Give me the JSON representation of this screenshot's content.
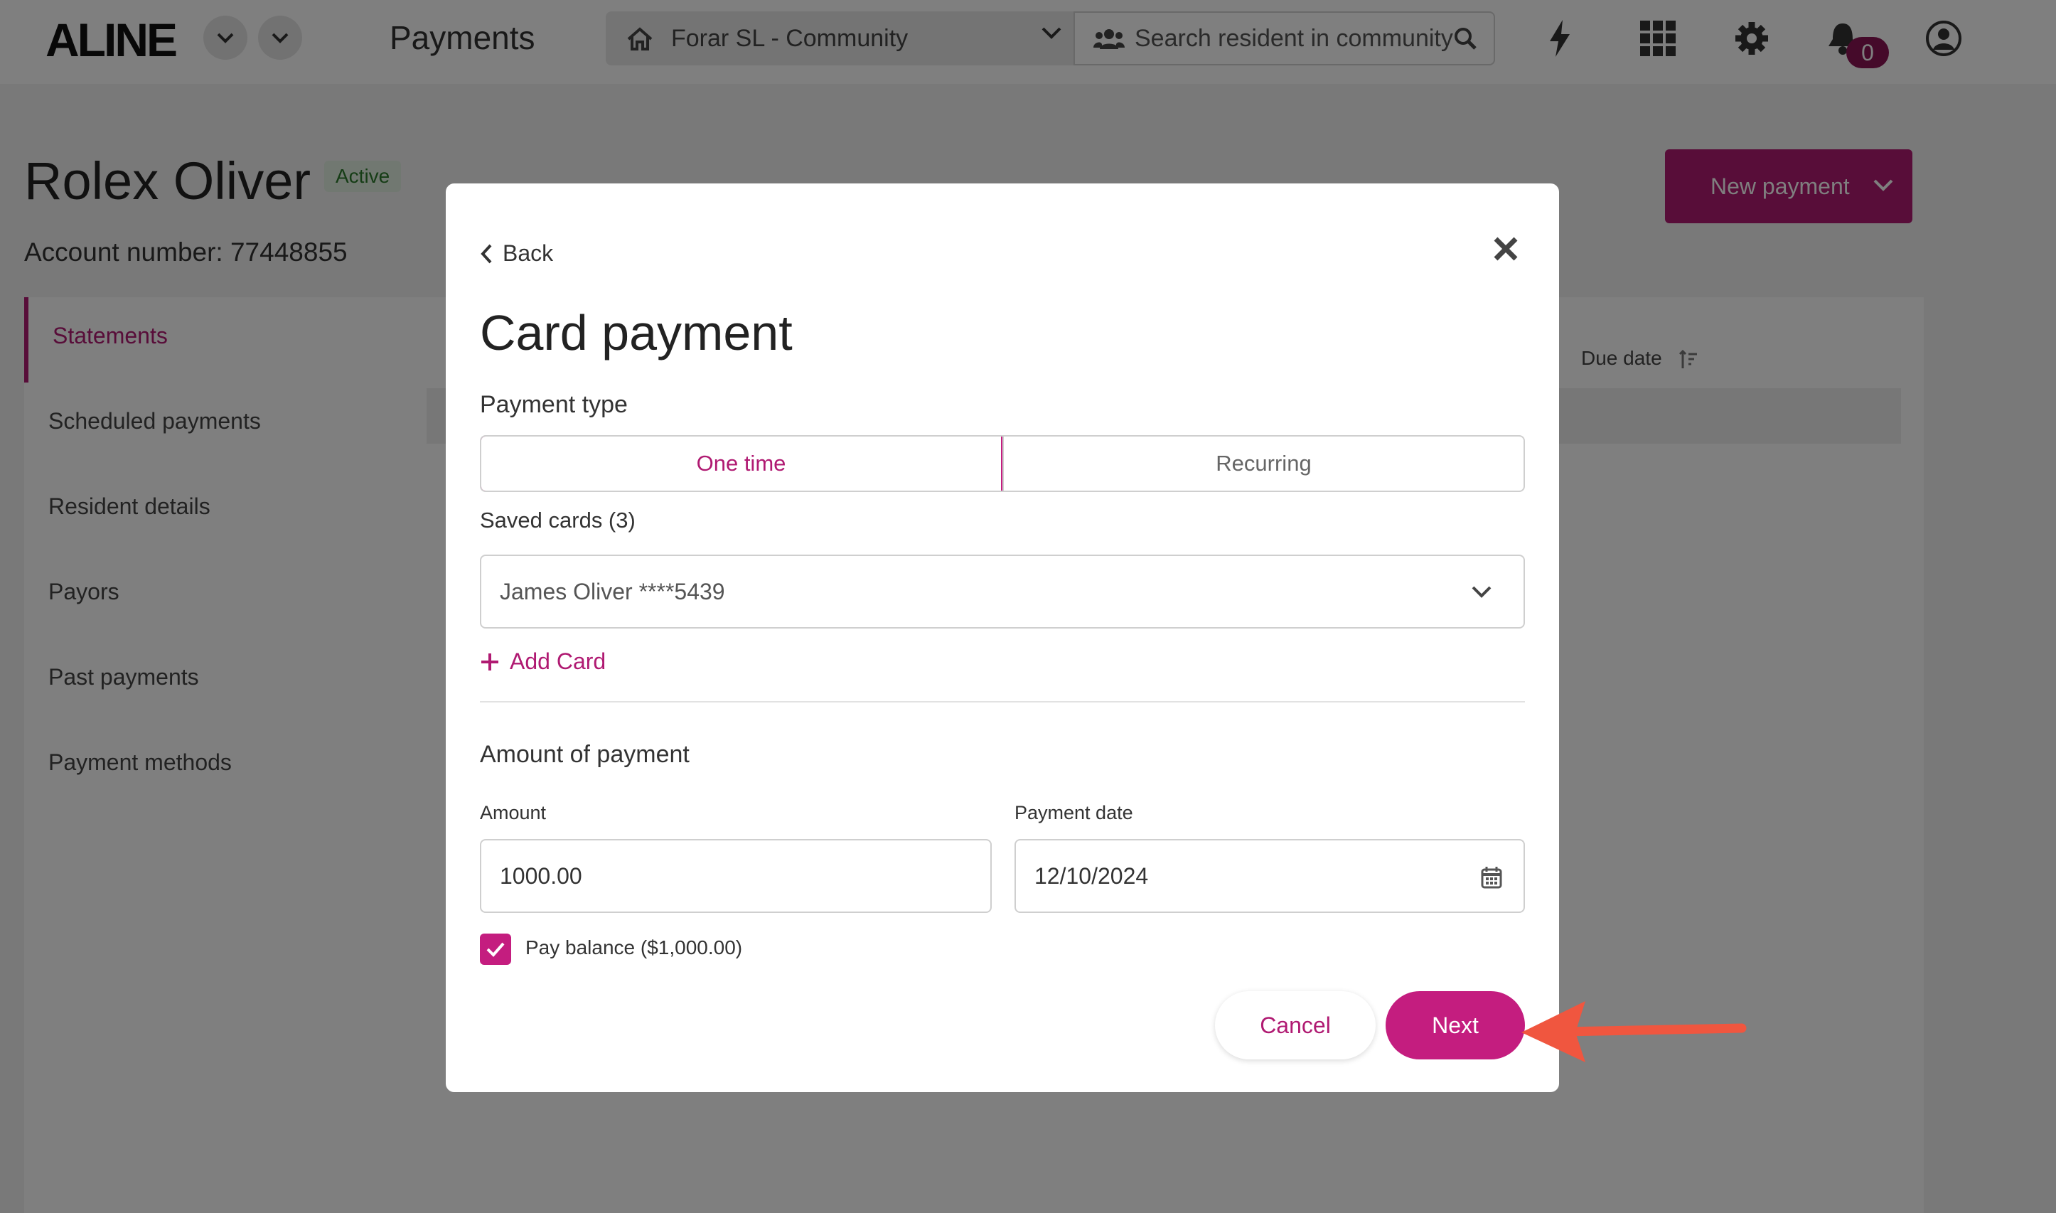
{
  "topbar": {
    "logo": "ALINE",
    "title": "Payments",
    "community": "Forar SL - Community",
    "search_placeholder": "Search resident in community",
    "notification_count": "0"
  },
  "resident": {
    "name": "Rolex Oliver",
    "status": "Active",
    "account_number": "Account number: 77448855"
  },
  "new_payment_label": "New payment",
  "sidebar": {
    "items": [
      {
        "label": "Statements"
      },
      {
        "label": "Scheduled payments"
      },
      {
        "label": "Resident details"
      },
      {
        "label": "Payors"
      },
      {
        "label": "Past payments"
      },
      {
        "label": "Payment methods"
      }
    ]
  },
  "table": {
    "due_date_header": "Due date"
  },
  "modal": {
    "back_label": "Back",
    "title": "Card payment",
    "payment_type_label": "Payment type",
    "payment_types": [
      "One time",
      "Recurring"
    ],
    "selected_payment_type": "One time",
    "saved_cards_label": "Saved cards (3)",
    "selected_card": "James Oliver ****5439",
    "add_card_label": "Add Card",
    "amount_section_label": "Amount of payment",
    "amount_label": "Amount",
    "amount_value": "1000.00",
    "payment_date_label": "Payment date",
    "payment_date_value": "12/10/2024",
    "pay_balance_label": "Pay balance ($1,000.00)",
    "pay_balance_checked": true,
    "cancel_label": "Cancel",
    "next_label": "Next"
  },
  "colors": {
    "accent": "#c41d7f",
    "accent_dark": "#8a1454",
    "annotation_arrow": "#f0563f"
  }
}
